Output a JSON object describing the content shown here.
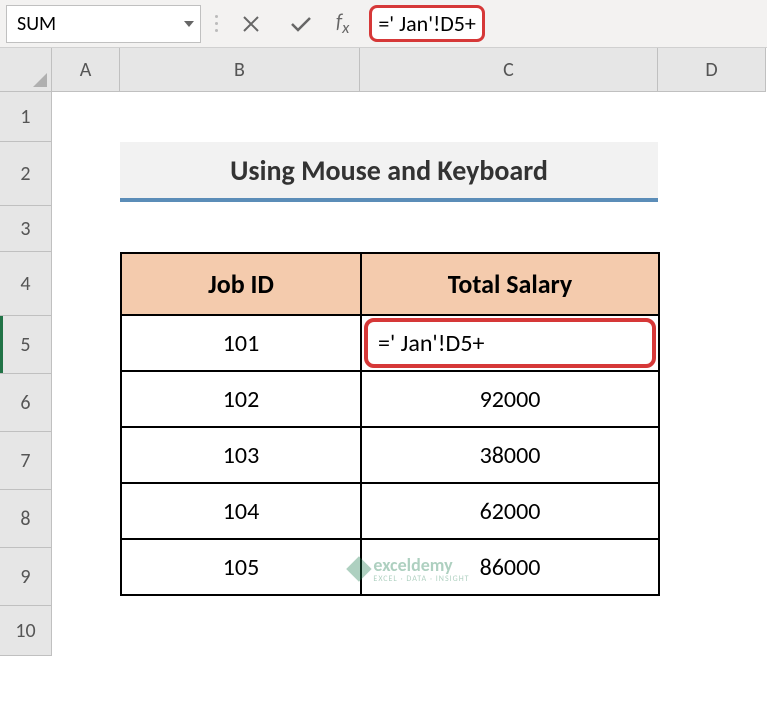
{
  "nameBox": "SUM",
  "formulaBar": "=' Jan'!D5+",
  "columns": [
    "A",
    "B",
    "C",
    "D"
  ],
  "rows": [
    "1",
    "2",
    "3",
    "4",
    "5",
    "6",
    "7",
    "8",
    "9",
    "10"
  ],
  "activeRow": "5",
  "title": "Using Mouse and Keyboard",
  "table": {
    "headers": {
      "id": "Job ID",
      "salary": "Total Salary"
    },
    "data": [
      {
        "id": "101",
        "salary": "=' Jan'!D5+"
      },
      {
        "id": "102",
        "salary": "92000"
      },
      {
        "id": "103",
        "salary": "38000"
      },
      {
        "id": "104",
        "salary": "62000"
      },
      {
        "id": "105",
        "salary": "86000"
      }
    ]
  },
  "editingCell": "C5",
  "editingValue": "=' Jan'!D5+",
  "watermark": {
    "brand": "exceldemy",
    "tagline": "EXCEL · DATA · INSIGHT"
  }
}
